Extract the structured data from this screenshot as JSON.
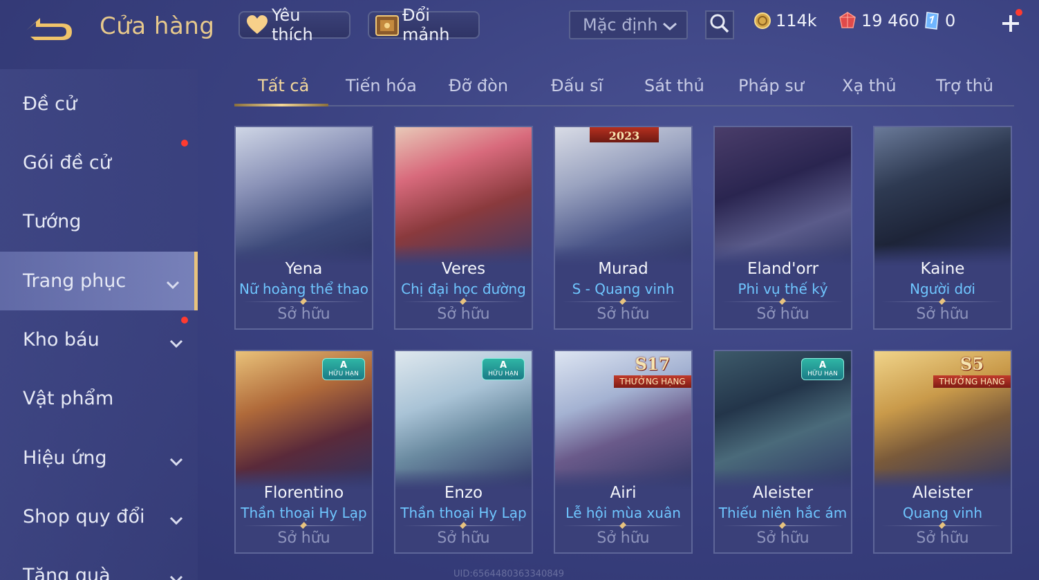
{
  "header": {
    "title": "Cửa hàng",
    "favorites_label": "Yêu thích",
    "shard_exchange_label": "Đổi mảnh",
    "sort_value": "Mặc định",
    "gold": "114k",
    "gems": "19 460",
    "tickets": "0"
  },
  "sidebar": {
    "items": [
      {
        "label": "Đề cử"
      },
      {
        "label": "Gói đề cử"
      },
      {
        "label": "Tướng"
      },
      {
        "label": "Trang phục"
      },
      {
        "label": "Kho báu"
      },
      {
        "label": "Vật phẩm"
      },
      {
        "label": "Hiệu ứng"
      },
      {
        "label": "Shop quy đổi"
      },
      {
        "label": "Tặng quà"
      }
    ]
  },
  "tabs": [
    "Tất cả",
    "Tiến hóa",
    "Đỡ đòn",
    "Đấu sĩ",
    "Sát thủ",
    "Pháp sư",
    "Xạ thủ",
    "Trợ thủ"
  ],
  "cards": [
    {
      "hero": "Yena",
      "skin": "Nữ hoàng thể thao",
      "status": "Sở hữu"
    },
    {
      "hero": "Veres",
      "skin": "Chị đại học đường",
      "status": "Sở hữu"
    },
    {
      "hero": "Murad",
      "skin": "S - Quang vinh",
      "status": "Sở hữu",
      "year_badge": "2023"
    },
    {
      "hero": "Eland'orr",
      "skin": "Phi vụ thế kỷ",
      "status": "Sở hữu"
    },
    {
      "hero": "Kaine",
      "skin": "Người dơi",
      "status": "Sở hữu"
    },
    {
      "hero": "Florentino",
      "skin": "Thần thoại Hy Lạp",
      "status": "Sở hữu",
      "badge_grade": "A",
      "badge_text": "HỮU HẠN"
    },
    {
      "hero": "Enzo",
      "skin": "Thần thoại Hy Lạp",
      "status": "Sở hữu",
      "badge_grade": "A",
      "badge_text": "HỮU HẠN"
    },
    {
      "hero": "Airi",
      "skin": "Lễ hội mùa xuân",
      "status": "Sở hữu",
      "season_badge": "S17",
      "rank_badge": "THƯỞNG HẠNG"
    },
    {
      "hero": "Aleister",
      "skin": "Thiếu niên hắc ám",
      "status": "Sở hữu",
      "badge_grade": "A",
      "badge_text": "HỮU HẠN"
    },
    {
      "hero": "Aleister",
      "skin": "Quang vinh",
      "status": "Sở hữu",
      "season_badge": "S5",
      "rank_badge": "THƯỞNG HẠNG"
    }
  ],
  "footer": {
    "uid": "UID:6564480363340849"
  },
  "colors": {
    "accent_gold": "#e7c98c",
    "skin_blue": "#6fc6ff",
    "notification_red": "#ff3b30"
  }
}
